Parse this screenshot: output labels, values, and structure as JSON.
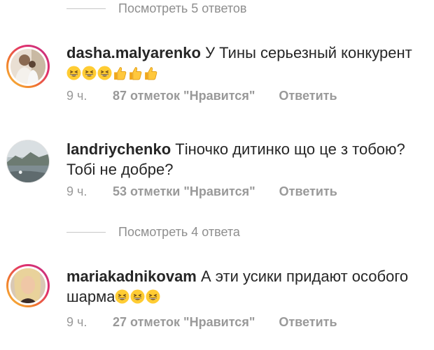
{
  "threads": [
    {
      "view_replies": "Посмотреть 5 ответов"
    }
  ],
  "comments": [
    {
      "username": "dasha.malyarenko",
      "text": " У Тины серьезный конкурент",
      "emojis": [
        "grinning-squint-face",
        "grinning-squint-face",
        "grinning-squint-face",
        "thumbs-up",
        "thumbs-up",
        "thumbs-up"
      ],
      "time": "9 ч.",
      "likes": "87 отметок \"Нравится\"",
      "reply": "Ответить"
    },
    {
      "username": "landriychenko",
      "text": " Тіночко дитинко що це з тобою? Тобі не добре?",
      "emojis": [],
      "time": "9 ч.",
      "likes": "53 отметки \"Нравится\"",
      "reply": "Ответить"
    },
    {
      "view_replies": "Посмотреть 4 ответа"
    },
    {
      "username": "mariakadnikovam",
      "text": " А эти усики придают особого шарма",
      "emojis": [
        "grinning-squint-face",
        "grinning-squint-face",
        "grinning-squint-face"
      ],
      "time": "9 ч.",
      "likes": "27 отметок \"Нравится\"",
      "reply": "Ответить"
    }
  ],
  "colors": {
    "text": "#262626",
    "muted": "#8e8e8e",
    "meta": "#999999",
    "story_ring_start": "#f9c33c",
    "story_ring_end": "#c13584",
    "emoji_yellow": "#ffcc33"
  }
}
